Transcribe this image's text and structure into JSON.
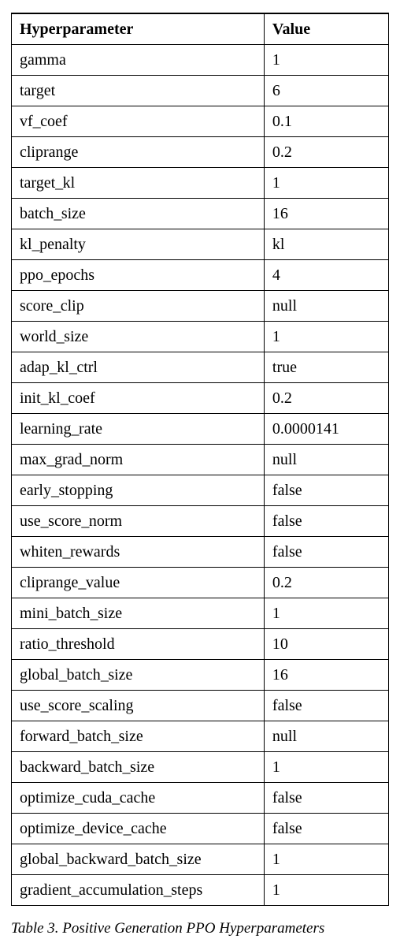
{
  "chart_data": {
    "type": "table",
    "columns": [
      "Hyperparameter",
      "Value"
    ],
    "rows": [
      {
        "param": "gamma",
        "value": "1"
      },
      {
        "param": "target",
        "value": "6"
      },
      {
        "param": "vf_coef",
        "value": "0.1"
      },
      {
        "param": "cliprange",
        "value": "0.2"
      },
      {
        "param": "target_kl",
        "value": "1"
      },
      {
        "param": "batch_size",
        "value": "16"
      },
      {
        "param": "kl_penalty",
        "value": "kl"
      },
      {
        "param": "ppo_epochs",
        "value": "4"
      },
      {
        "param": "score_clip",
        "value": "null"
      },
      {
        "param": "world_size",
        "value": "1"
      },
      {
        "param": "adap_kl_ctrl",
        "value": "true"
      },
      {
        "param": "init_kl_coef",
        "value": "0.2"
      },
      {
        "param": "learning_rate",
        "value": "0.0000141"
      },
      {
        "param": "max_grad_norm",
        "value": "null"
      },
      {
        "param": "early_stopping",
        "value": "false"
      },
      {
        "param": "use_score_norm",
        "value": "false"
      },
      {
        "param": "whiten_rewards",
        "value": "false"
      },
      {
        "param": "cliprange_value",
        "value": "0.2"
      },
      {
        "param": "mini_batch_size",
        "value": "1"
      },
      {
        "param": "ratio_threshold",
        "value": "10"
      },
      {
        "param": "global_batch_size",
        "value": "16"
      },
      {
        "param": "use_score_scaling",
        "value": "false"
      },
      {
        "param": "forward_batch_size",
        "value": "null"
      },
      {
        "param": "backward_batch_size",
        "value": "1"
      },
      {
        "param": "optimize_cuda_cache",
        "value": "false"
      },
      {
        "param": "optimize_device_cache",
        "value": "false"
      },
      {
        "param": "global_backward_batch_size",
        "value": "1"
      },
      {
        "param": "gradient_accumulation_steps",
        "value": "1"
      }
    ]
  },
  "caption_prefix": "Table 3.",
  "caption_text": " Positive Generation PPO Hyperparameters"
}
